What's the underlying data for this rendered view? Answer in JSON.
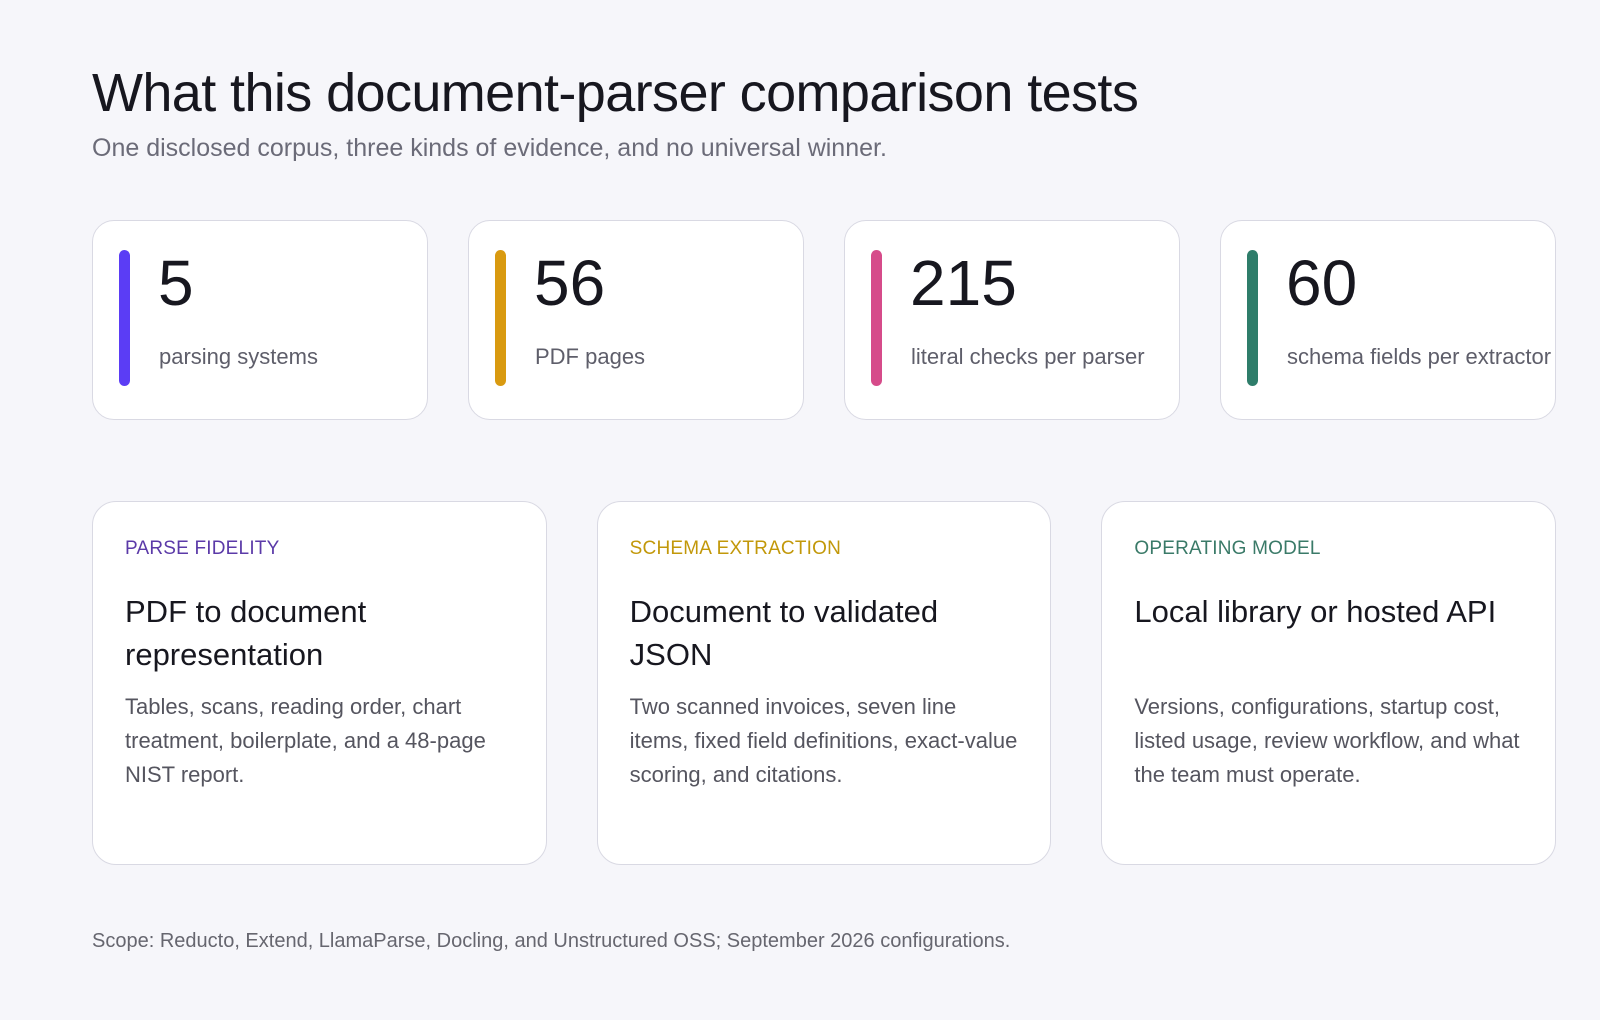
{
  "header": {
    "title": "What this document-parser comparison tests",
    "subtitle": "One disclosed corpus, three kinds of evidence, and no universal winner."
  },
  "stats": [
    {
      "value": "5",
      "label": "parsing systems",
      "color": "#5b3df5"
    },
    {
      "value": "56",
      "label": "PDF pages",
      "color": "#d99a10"
    },
    {
      "value": "215",
      "label": "literal checks per parser",
      "color": "#d64b8a"
    },
    {
      "value": "60",
      "label": "schema fields per extractor",
      "color": "#2e7d6a"
    }
  ],
  "features": [
    {
      "eyebrow": "PARSE FIDELITY",
      "eyebrow_color": "#5b3aa8",
      "heading": "PDF to document representation",
      "body": "Tables, scans, reading order, chart treatment, boilerplate, and a 48-page NIST report."
    },
    {
      "eyebrow": "SCHEMA EXTRACTION",
      "eyebrow_color": "#c2980a",
      "heading": "Document to validated JSON",
      "body": "Two scanned invoices, seven line items, fixed field definitions, exact-value scoring, and citations."
    },
    {
      "eyebrow": "OPERATING MODEL",
      "eyebrow_color": "#3a7a68",
      "heading": "Local library or hosted API",
      "body": "Versions, configurations, startup cost, listed usage, review workflow, and what the team must operate."
    }
  ],
  "footnote": "Scope: Reducto, Extend, LlamaParse, Docling, and Unstructured OSS; September 2026 configurations."
}
